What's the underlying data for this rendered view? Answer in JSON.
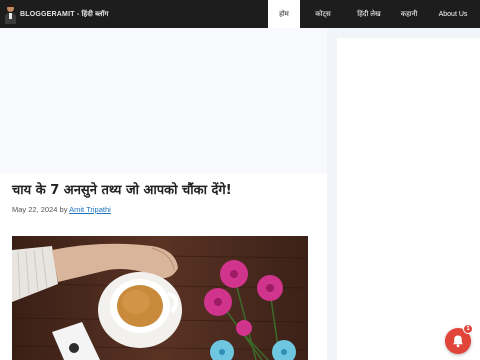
{
  "header": {
    "logo_text": "BLOGGERAMIT - हिंदी ब्लॉग",
    "nav": [
      {
        "label": "होम",
        "active": true
      },
      {
        "label": "कोट्स",
        "active": false
      },
      {
        "label": "हिंदी लेख",
        "active": false
      },
      {
        "label": "कहानी",
        "active": false
      },
      {
        "label": "About Us",
        "active": false
      }
    ]
  },
  "article": {
    "title": "चाय के 7 अनसुने तथ्य जो आपको चौंका देंगे!",
    "date": "May 22, 2024",
    "by": "by",
    "author": "Amit Tripathi"
  },
  "notification": {
    "badge_count": "1"
  },
  "colors": {
    "header_bg": "#1d1d1d",
    "link": "#1e73be",
    "bell": "#e1453a",
    "page_bg": "#f1f4f9"
  }
}
